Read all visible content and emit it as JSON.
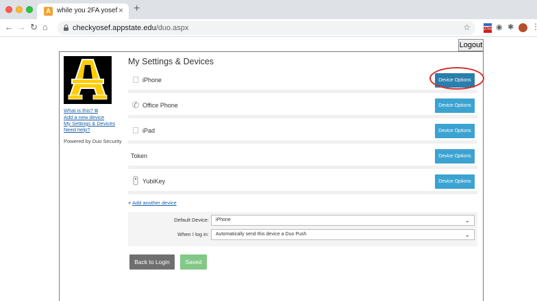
{
  "browser": {
    "tab_title": "while you 2FA yosef",
    "tab_close": "×",
    "new_tab": "+",
    "favicon_letter": "A",
    "url_host": "checkyosef.appstate.edu",
    "url_path": "/duo.aspx",
    "extension_badge": "27m"
  },
  "page": {
    "logout_label": "Logout",
    "title": "My Settings & Devices",
    "left_links": [
      "What is this?",
      "Add a new device",
      "My Settings & Devices",
      "Need help?"
    ],
    "powered_by": "Powered by Duo Security",
    "devices": [
      {
        "name": "iPhone",
        "icon": "apple-icon",
        "button": "Device Options",
        "highlighted": true
      },
      {
        "name": "Office Phone",
        "icon": "phone-handset-icon",
        "button": "Device Options",
        "highlighted": false
      },
      {
        "name": "iPad",
        "icon": "apple-icon",
        "button": "Device Options",
        "highlighted": false
      },
      {
        "name": "Token",
        "icon": "",
        "button": "Device Options",
        "highlighted": false
      },
      {
        "name": "YubiKey",
        "icon": "usb-key-icon",
        "button": "Device Options",
        "highlighted": false
      }
    ],
    "add_prefix": "+ ",
    "add_link": "Add another device",
    "default_device_label": "Default Device:",
    "default_device_value": "iPhone",
    "when_login_label": "When I log in:",
    "when_login_value": "Automatically send this device a Duo Push",
    "back_label": "Back to Login",
    "saved_label": "Saved"
  },
  "colors": {
    "device_button": "#3ca3d1",
    "highlight_ring": "#d62b2b",
    "saved_button": "#82c887",
    "back_button": "#6f6f6f"
  }
}
